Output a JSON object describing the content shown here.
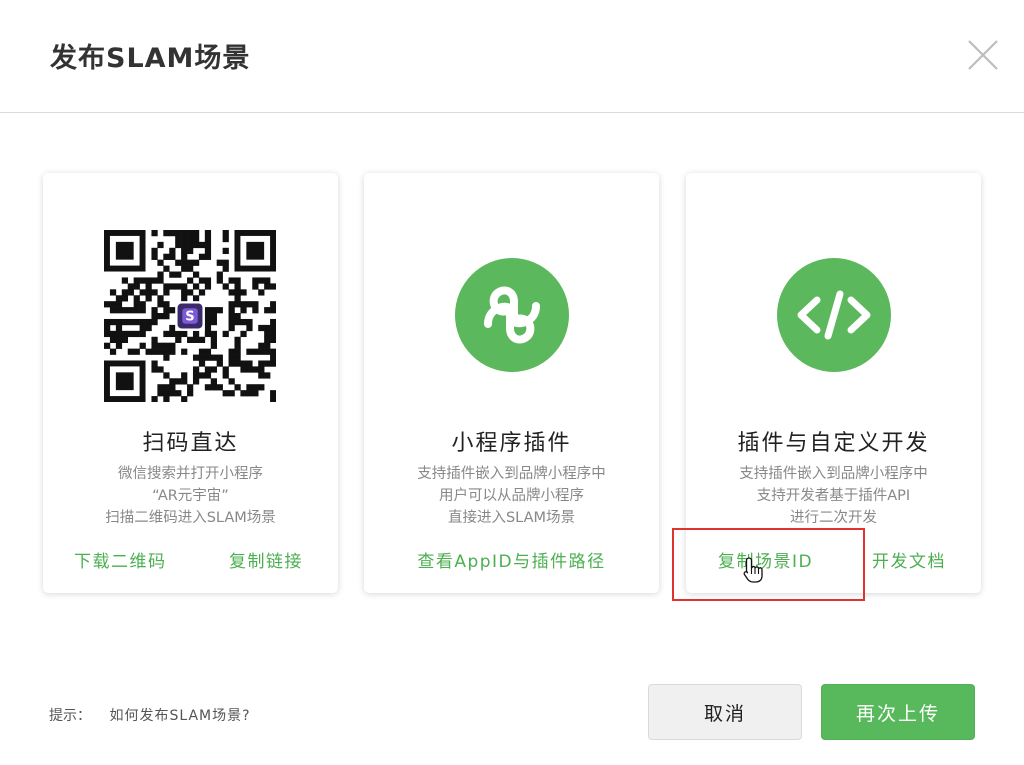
{
  "dialog": {
    "title": "发布SLAM场景"
  },
  "cards": [
    {
      "title": "扫码直达",
      "desc": [
        "微信搜索并打开小程序",
        "“AR元宇宙”",
        "扫描二维码进入SLAM场景"
      ],
      "links": [
        "下载二维码",
        "复制链接"
      ]
    },
    {
      "title": "小程序插件",
      "desc": [
        "支持插件嵌入到品牌小程序中",
        "用户可以从品牌小程序",
        "直接进入SLAM场景"
      ],
      "links": [
        "查看AppID与插件路径"
      ]
    },
    {
      "title": "插件与自定义开发",
      "desc": [
        "支持插件嵌入到品牌小程序中",
        "支持开发者基于插件API",
        "进行二次开发"
      ],
      "links": [
        "复制场景ID",
        "开发文档"
      ]
    }
  ],
  "hint": {
    "label": "提示：",
    "link": "如何发布SLAM场景?"
  },
  "buttons": {
    "cancel": "取消",
    "upload": "再次上传"
  },
  "colors": {
    "accent": "#5cb85c",
    "link": "#4caf50",
    "highlight": "#e0322f"
  },
  "icons": {
    "close": "close-icon",
    "qr": "qr-code",
    "mini_program": "mini-program-icon",
    "code": "code-icon",
    "cursor": "hand-cursor-icon"
  }
}
